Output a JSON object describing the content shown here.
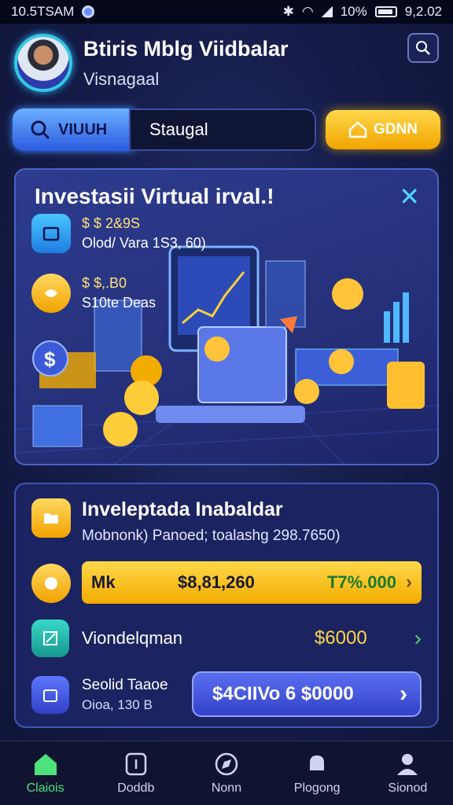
{
  "status_bar": {
    "time": "10.5TSAM",
    "battery": "10%",
    "clock": "9,2.02"
  },
  "header": {
    "title": "Btiris Mblg Viidbalar",
    "subtitle": "Visnagaal"
  },
  "tabs": {
    "active_label": "VIUUH",
    "input_value": "Staugal",
    "gold_label": "GDNN"
  },
  "hero": {
    "title": "Investasii Virtual irval.!",
    "item1": {
      "line1": "$ $ 2&9S",
      "line2": "Olod/ Vara 1S3, 60)"
    },
    "item2": {
      "line1": "$ $,.B0",
      "line2": "S10te Deas"
    }
  },
  "panel": {
    "title": "Inveleptada Inabaldar",
    "description": "Mobnonk) Panoed; toalashg 298.7650)",
    "row1": {
      "label": "Mk",
      "value": "$8,81,260",
      "value2": "T7%.000"
    },
    "row2": {
      "label": "Viondelqman",
      "value": "$6000"
    },
    "row3": {
      "label": "Seolid Taaoe",
      "sublabel": "Oioa, 130 B",
      "button": "$4CIIVo 6 $0000"
    }
  },
  "nav": {
    "items": [
      "Claiois",
      "Doddb",
      "Nonn",
      "Plogong",
      "Sionod"
    ]
  },
  "colors": {
    "accent_gold": "#f2ac00",
    "accent_green": "#4ee37a",
    "accent_cyan": "#4fd6ff"
  }
}
